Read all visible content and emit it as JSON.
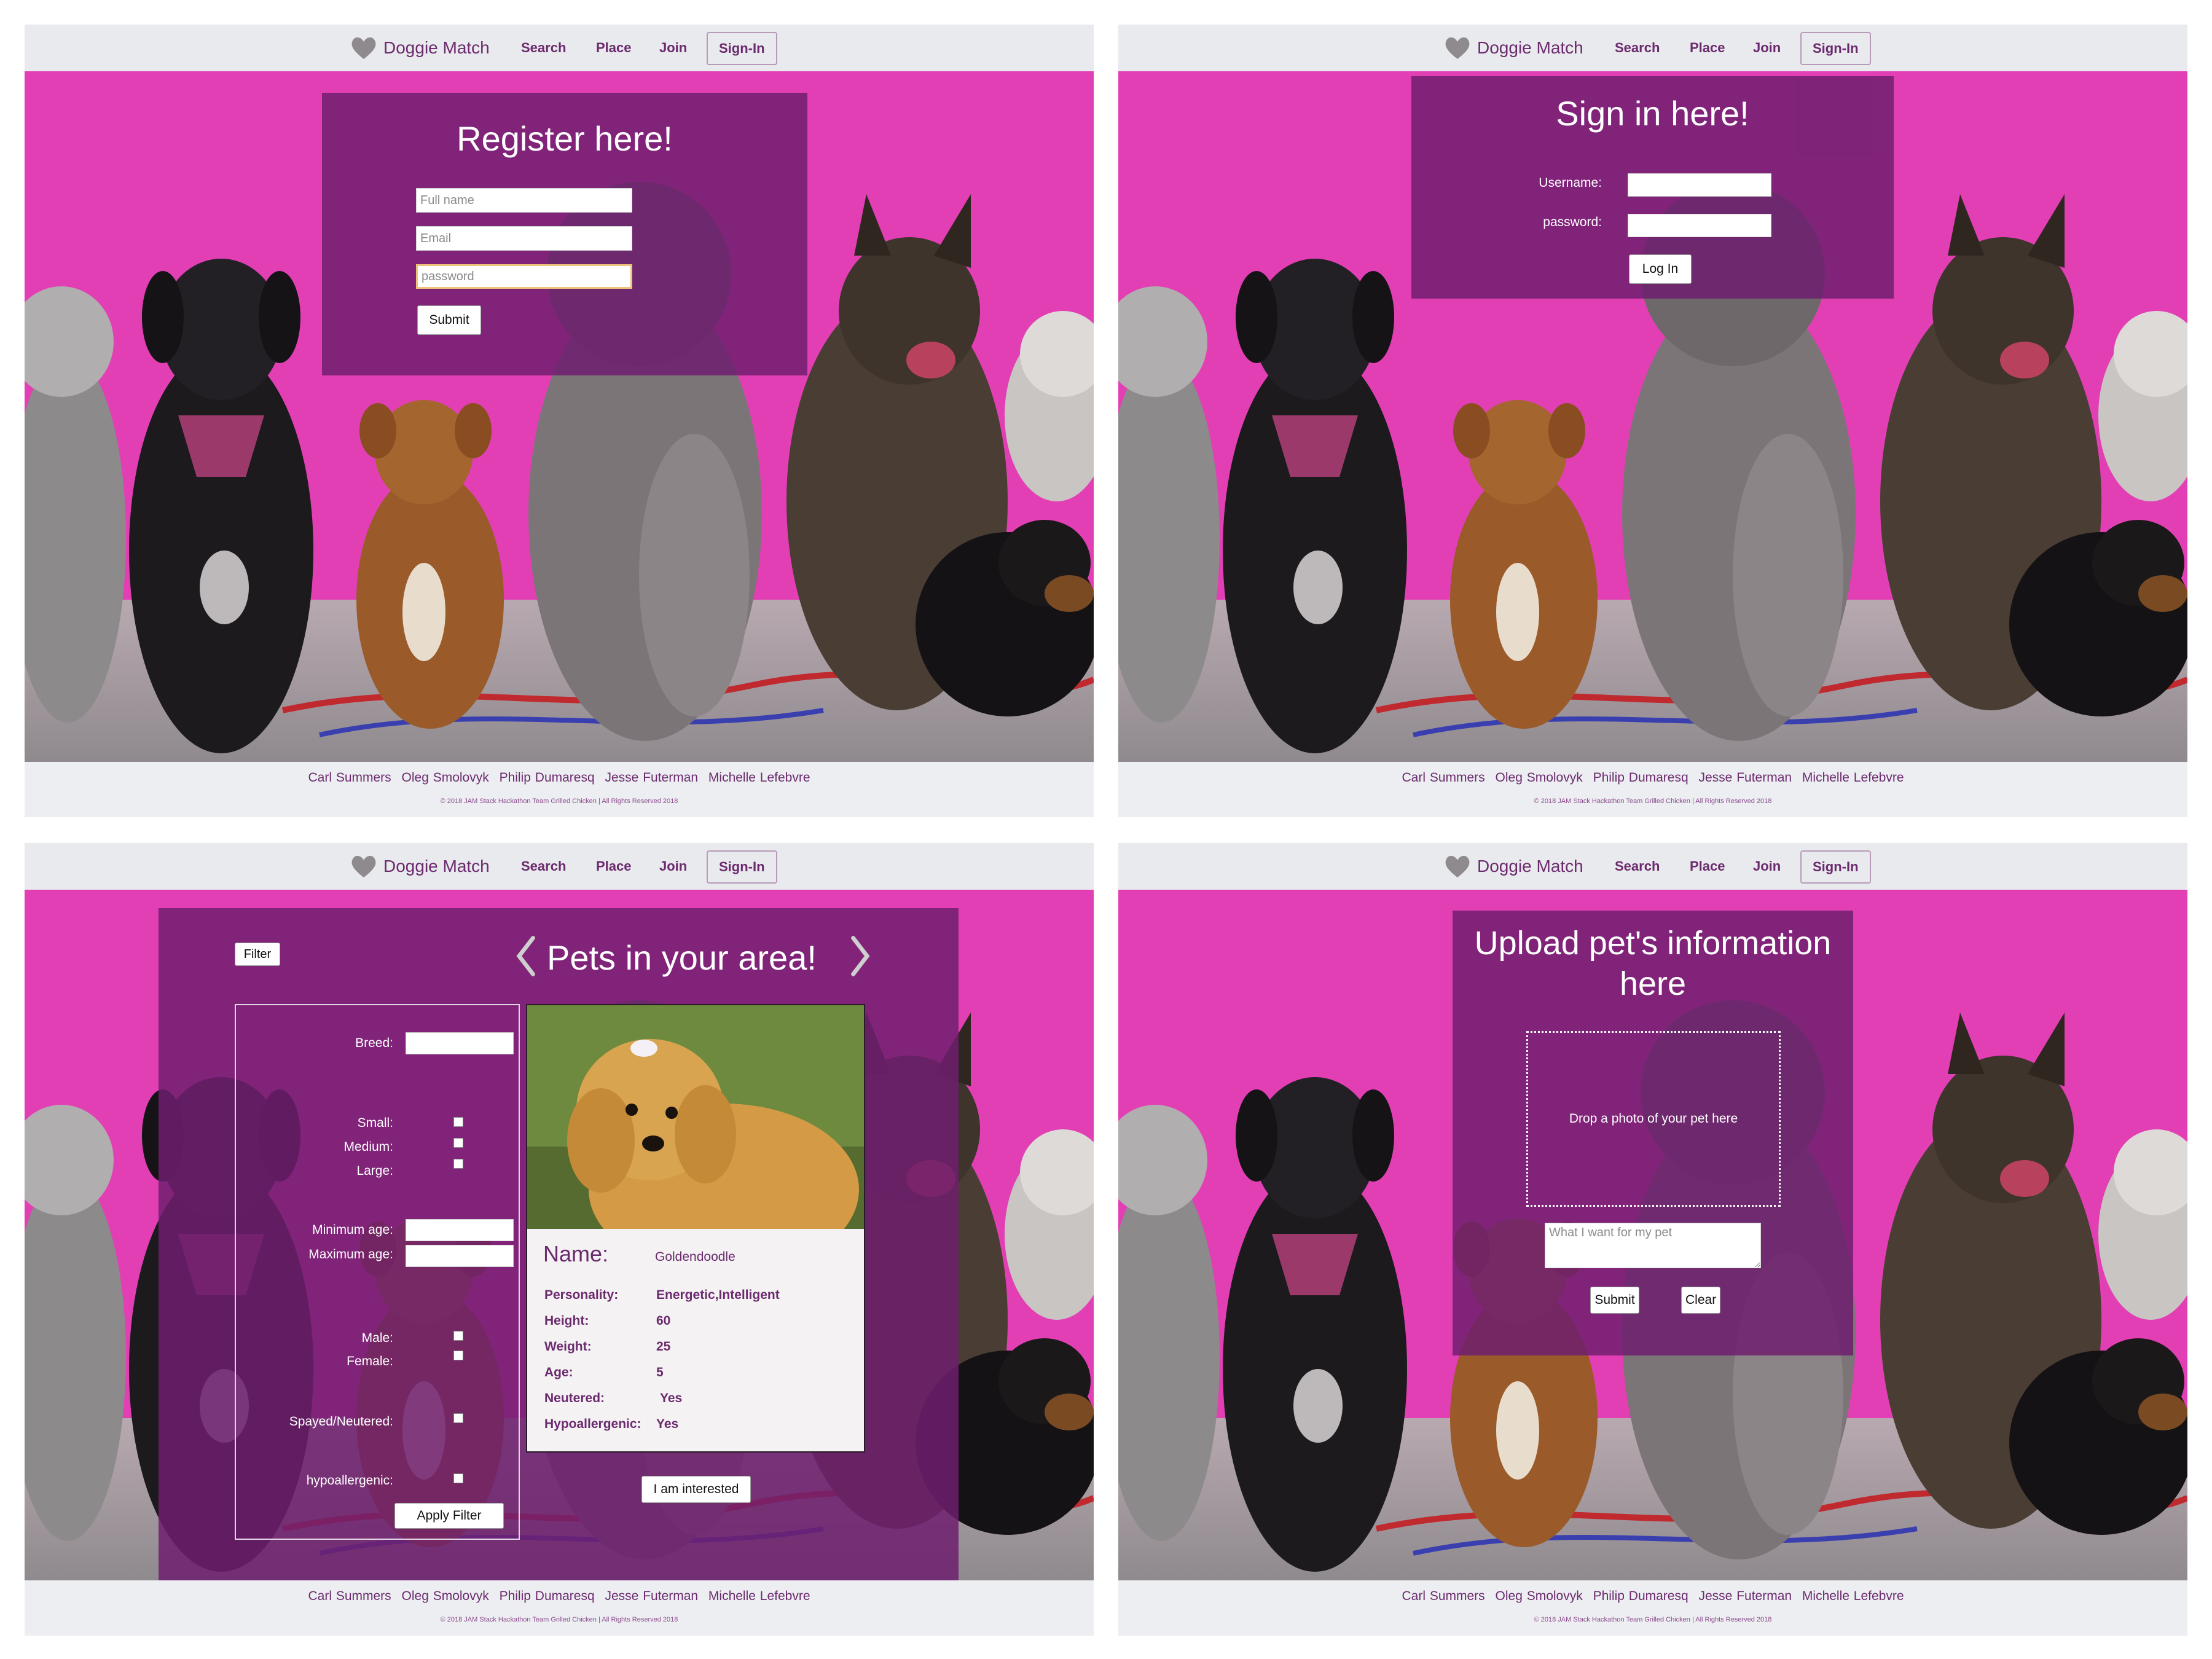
{
  "nav": {
    "brand": "Doggie Match",
    "search": "Search",
    "place": "Place",
    "join": "Join",
    "signin": "Sign-In"
  },
  "footer": {
    "credits": [
      "Carl Summers",
      "Oleg Smolovyk",
      "Philip Dumaresq",
      "Jesse Futerman",
      "Michelle Lefebvre"
    ],
    "copyright": "© 2018 JAM Stack Hackathon Team Grilled Chicken | All Rights Reserved 2018"
  },
  "register": {
    "title": "Register here!",
    "fullname_placeholder": "Full name",
    "email_placeholder": "Email",
    "password_placeholder": "password",
    "submit": "Submit"
  },
  "signin": {
    "title": "Sign in here!",
    "username_label": "Username:",
    "password_label": "password:",
    "login": "Log In"
  },
  "pets": {
    "filter_button": "Filter",
    "title": "Pets in your area!",
    "breed_label": "Breed:",
    "small_label": "Small:",
    "medium_label": "Medium:",
    "large_label": "Large:",
    "min_age_label": "Minimum age:",
    "max_age_label": "Maximum age:",
    "male_label": "Male:",
    "female_label": "Female:",
    "spayed_label": "Spayed/Neutered:",
    "hypo_label": "hypoallergenic:",
    "apply_filter": "Apply Filter",
    "interested": "I am interested",
    "card": {
      "name_label": "Name:",
      "name": "Goldendoodle",
      "personality_label": "Personality:",
      "personality": "Energetic,Intelligent",
      "height_label": "Height:",
      "height": "60",
      "weight_label": "Weight:",
      "weight": "25",
      "age_label": "Age:",
      "age": "5",
      "neutered_label": "Neutered:",
      "neutered": "Yes",
      "hypo_label": "Hypoallergenic:",
      "hypo": "Yes"
    }
  },
  "upload": {
    "title_line1": "Upload pet's information",
    "title_line2": "here",
    "drop_text": "Drop a photo of your pet here",
    "want_placeholder": "What I want for my pet",
    "submit": "Submit",
    "clear": "Clear"
  },
  "colors": {
    "brand_purple": "#6b2a6e",
    "overlay_purple": "#6e1e6e",
    "wall_pink": "#e23fb5"
  },
  "icons": {
    "brand": "heart-icon",
    "prev": "chevron-left-icon",
    "next": "chevron-right-icon"
  }
}
